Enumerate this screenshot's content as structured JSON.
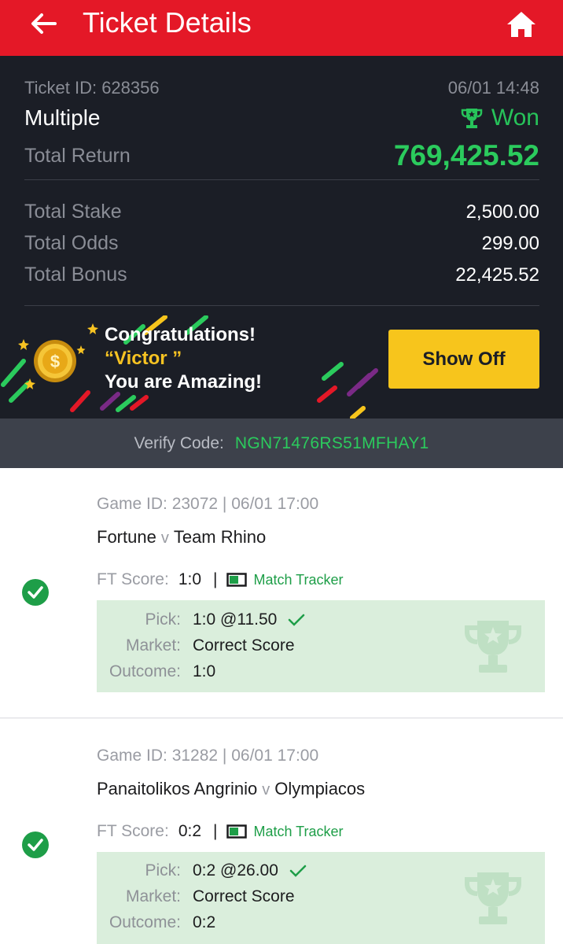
{
  "header": {
    "title": "Ticket Details",
    "back_icon": "arrow-left-icon",
    "home_icon": "home-icon"
  },
  "ticket": {
    "id_text": "Ticket ID: 628356",
    "date": "06/01 14:48",
    "type": "Multiple",
    "status": "Won",
    "total_return_label": "Total Return",
    "total_return": "769,425.52",
    "total_stake_label": "Total Stake",
    "total_stake": "2,500.00",
    "total_odds_label": "Total Odds",
    "total_odds": "299.00",
    "total_bonus_label": "Total Bonus",
    "total_bonus": "22,425.52"
  },
  "congrats": {
    "line1": "Congratulations!",
    "name": "“Victor ”",
    "line3": "You are Amazing!",
    "button": "Show Off"
  },
  "verify": {
    "label": "Verify Code:",
    "code": "NGN71476RS51MFHAY1"
  },
  "games": [
    {
      "game_id": "Game ID: 23072 | 06/01 17:00",
      "home": "Fortune",
      "vs": "v",
      "away": "Team Rhino",
      "ft_label": "FT Score:",
      "ft_score": "1:0",
      "sep": "|",
      "tracker": "Match Tracker",
      "pick_label": "Pick:",
      "pick": "1:0 @11.50",
      "market_label": "Market:",
      "market": "Correct Score",
      "outcome_label": "Outcome:",
      "outcome": "1:0"
    },
    {
      "game_id": "Game ID: 31282 | 06/01 17:00",
      "home": "Panaitolikos Angrinio",
      "vs": "v",
      "away": "Olympiacos",
      "ft_label": "FT Score:",
      "ft_score": "0:2",
      "sep": "|",
      "tracker": "Match Tracker",
      "pick_label": "Pick:",
      "pick": "0:2 @26.00",
      "market_label": "Market:",
      "market": "Correct Score",
      "outcome_label": "Outcome:",
      "outcome": "0:2"
    }
  ],
  "colors": {
    "header_red": "#e41827",
    "win_green": "#2bcb5d",
    "dark_panel": "#1b1e26",
    "gold": "#f7c51c",
    "pick_bg": "#daeedc"
  }
}
